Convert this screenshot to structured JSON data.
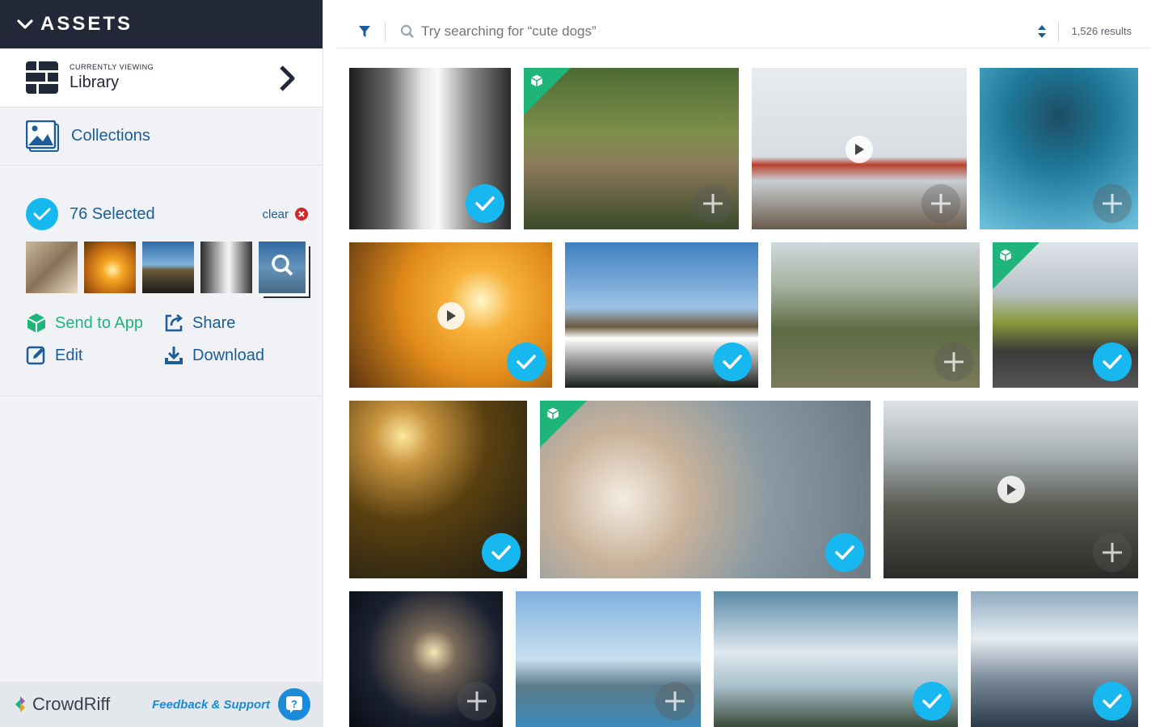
{
  "sidebar": {
    "header_title": "ASSETS",
    "viewing_label": "CURRENTLY VIEWING",
    "viewing_value": "Library",
    "collections_label": "Collections",
    "selected_label": "76 Selected",
    "clear_label": "clear",
    "thumbnails": [
      {
        "name": "cat",
        "bg": "linear-gradient(135deg,#c9b79c,#8a7256 50%,#e8dcc6)"
      },
      {
        "name": "sunset",
        "bg": "radial-gradient(circle at 55% 55%,#fff3b0 0%,#f5a623 25%,#c26a13 60%,#5a3608 100%)"
      },
      {
        "name": "mountain",
        "bg": "linear-gradient(180deg,#2d6aa8 0%,#7fb2dc 45%,#6b5a3a 55%,#1a1a1a 100%)"
      },
      {
        "name": "waterfall",
        "bg": "linear-gradient(90deg,#2a2a2a,#d8d8d8 45%,#f5f5f5 55%,#333 100%)"
      },
      {
        "name": "more",
        "bg": "linear-gradient(180deg,#3c78b8,#8fb9de 50%,#5c7a8c)"
      }
    ],
    "actions": [
      {
        "label": "Send to App",
        "icon": "cube-icon"
      },
      {
        "label": "Share",
        "icon": "share-icon"
      },
      {
        "label": "Edit",
        "icon": "edit-icon"
      },
      {
        "label": "Download",
        "icon": "download-icon"
      }
    ],
    "footer": {
      "brand": "CrowdRiff",
      "feedback": "Feedback & Support"
    }
  },
  "search": {
    "placeholder": "Try searching for “cute dogs”",
    "results": "1,526 results"
  },
  "colors": {
    "accent": "#17b7f0",
    "green": "#1fb47a",
    "navy": "#232838",
    "link": "#1b5c99"
  },
  "tiles": [
    {
      "name": "waterfall",
      "state": "selected",
      "video": false,
      "app": false,
      "bg": "linear-gradient(90deg,#1e1e1e 0%,#6b6b6b 25%,#e6e6e6 45%,#fafafa 55%,#8a8a8a 75%,#2b2b2b 100%)"
    },
    {
      "name": "hiker",
      "state": "add",
      "video": false,
      "app": true,
      "bg": "linear-gradient(180deg,#4d6b35 0%,#7d8f4a 40%,#8c7a5a 60%,#3a4a2a 100%)"
    },
    {
      "name": "golden-gate",
      "state": "add",
      "video": true,
      "app": false,
      "bg": "linear-gradient(180deg,#e8ecef 0%,#d8dde2 55%,#b8412e 60%,#c9cfd4 70%,#6b5a4a 100%)"
    },
    {
      "name": "polar-bear",
      "state": "add",
      "video": false,
      "app": false,
      "bg": "radial-gradient(circle at 50% 30%,#1d4d63 0%,#1f7a9c 40%,#6fc3e0 100%)"
    },
    {
      "name": "beach-sunset",
      "state": "selected",
      "video": true,
      "app": false,
      "bg": "radial-gradient(circle at 65% 40%,#fff6c8 0%,#f7b33c 20%,#e08a1a 50%,#5a3410 100%)"
    },
    {
      "name": "cloud-mountain",
      "state": "selected",
      "video": false,
      "app": false,
      "bg": "linear-gradient(180deg,#3f7fc0 0%,#9cc3e6 45%,#6a5a3c 58%,#ffffff 66%,#1a1f1a 100%)"
    },
    {
      "name": "great-wall",
      "state": "add",
      "video": false,
      "app": false,
      "bg": "linear-gradient(180deg,#cfd8dc 0%,#a7b2a0 30%,#5d6b43 60%,#7a7a5a 100%)"
    },
    {
      "name": "road",
      "state": "selected",
      "video": false,
      "app": true,
      "bg": "linear-gradient(180deg,#dfe4e8 0%,#b8c1c8 35%,#8a9a3a 55%,#3a3a3a 75%,#555 100%)"
    },
    {
      "name": "forest-car",
      "state": "selected",
      "video": false,
      "app": false,
      "bg": "radial-gradient(circle at 30% 20%,#ffe8a0 0%,#c99540 15%,#5a4010 45%,#1a1a14 100%)"
    },
    {
      "name": "puppy",
      "state": "selected",
      "video": false,
      "app": true,
      "bg": "radial-gradient(circle at 25% 55%,#f4ece2 0%,#c9b29a 25%,#8a9aa3 55%,#6b7a82 100%)"
    },
    {
      "name": "city-traffic",
      "state": "add",
      "video": true,
      "app": false,
      "bg": "linear-gradient(180deg,#dfe3e6 0%,#a8b0b4 30%,#5a5a52 60%,#2a2a28 100%)"
    },
    {
      "name": "concert",
      "state": "add",
      "video": false,
      "app": false,
      "bg": "radial-gradient(circle at 55% 45%,#f5e6b8 0%,#7a6a5a 20%,#1a2030 60%,#0a0c14 100%)"
    },
    {
      "name": "lake-jump",
      "state": "add",
      "video": false,
      "app": false,
      "bg": "linear-gradient(180deg,#7fb0de 0%,#c9dff0 50%,#5a7a8a 70%,#3c8ab8 100%)"
    },
    {
      "name": "sky-trees",
      "state": "selected",
      "video": false,
      "app": false,
      "bg": "linear-gradient(180deg,#5a8aa8 0%,#dfe8ee 45%,#a8c0cc 70%,#3a4a3a 100%)"
    },
    {
      "name": "snow-mountain",
      "state": "selected",
      "video": false,
      "app": false,
      "bg": "linear-gradient(180deg,#8faabf 0%,#e6edf2 35%,#7a8a98 65%,#2a3a48 100%)"
    }
  ]
}
